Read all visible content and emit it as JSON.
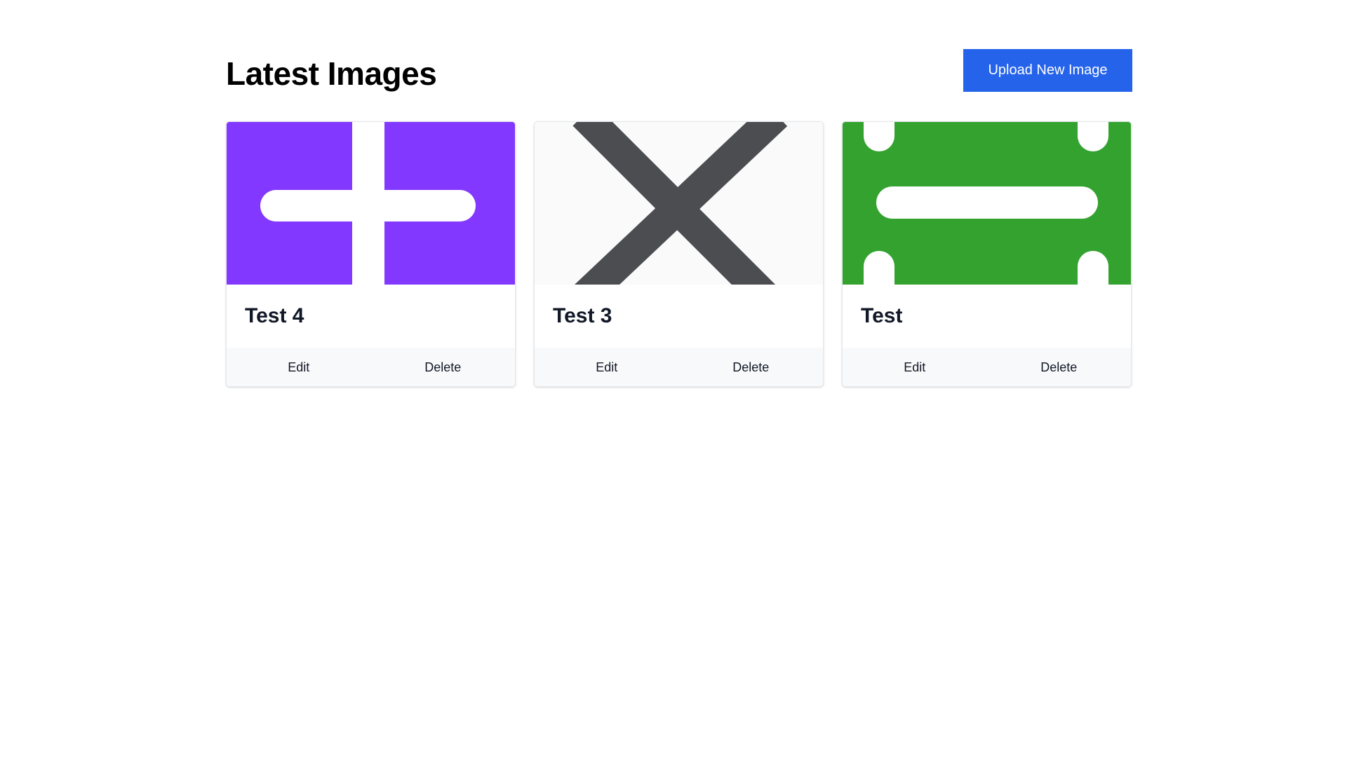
{
  "header": {
    "title": "Latest Images",
    "upload_label": "Upload New Image",
    "upload_color": "#2563eb"
  },
  "cards": [
    {
      "title": "Test 4",
      "image_icon": "plus-icon",
      "image_color": "#8338ff",
      "edit_label": "Edit",
      "delete_label": "Delete"
    },
    {
      "title": "Test 3",
      "image_icon": "multiply-icon",
      "image_color": "#4b4d51",
      "edit_label": "Edit",
      "delete_label": "Delete"
    },
    {
      "title": "Test",
      "image_icon": "equals-icon",
      "image_color": "#33a22f",
      "edit_label": "Edit",
      "delete_label": "Delete"
    }
  ]
}
